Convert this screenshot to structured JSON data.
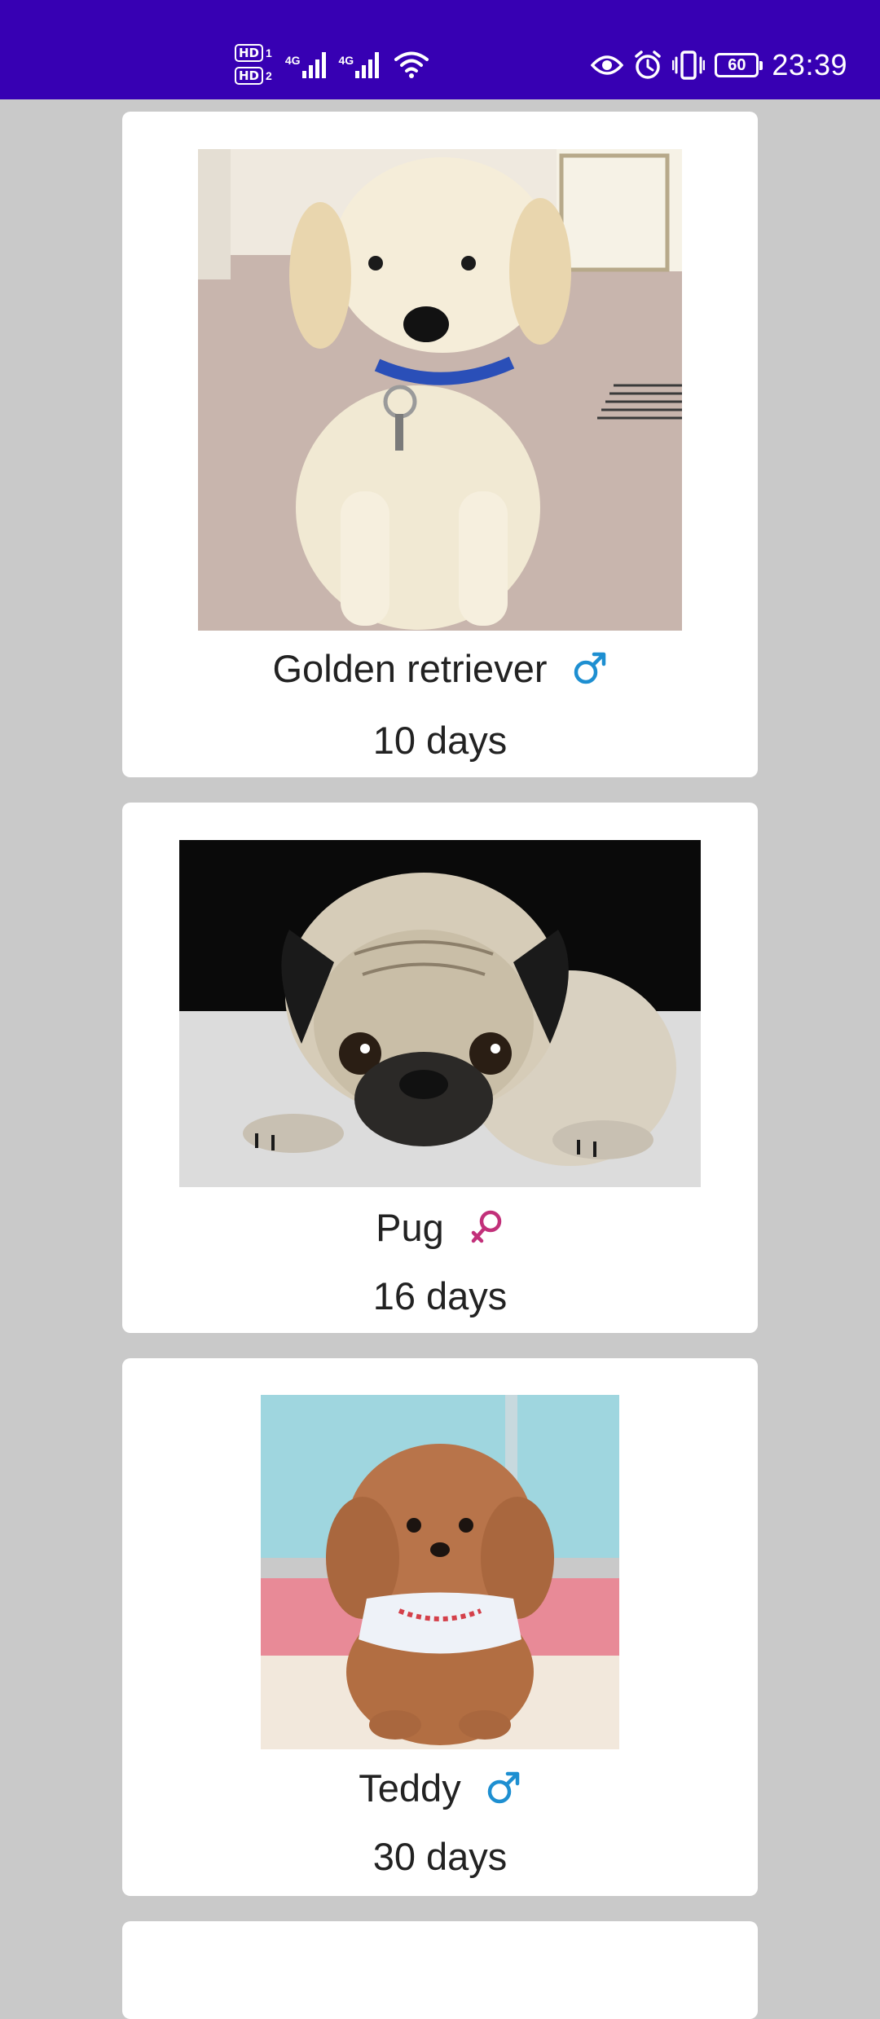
{
  "status_bar": {
    "hd1": "HD",
    "sim1": "1",
    "hd2": "HD",
    "sim2": "2",
    "network1": "4G",
    "network2": "4G",
    "battery": "60",
    "time": "23:39",
    "background": "#3700b3"
  },
  "pets": [
    {
      "name": "Golden retriever",
      "age": "10 days",
      "gender": "male",
      "gender_icon": "male-icon",
      "gender_color": "#1e8fd1"
    },
    {
      "name": "Pug",
      "age": "16 days",
      "gender": "female",
      "gender_icon": "female-icon",
      "gender_color": "#c2307a"
    },
    {
      "name": "Teddy",
      "age": "30 days",
      "gender": "male",
      "gender_icon": "male-icon",
      "gender_color": "#1e8fd1"
    }
  ]
}
